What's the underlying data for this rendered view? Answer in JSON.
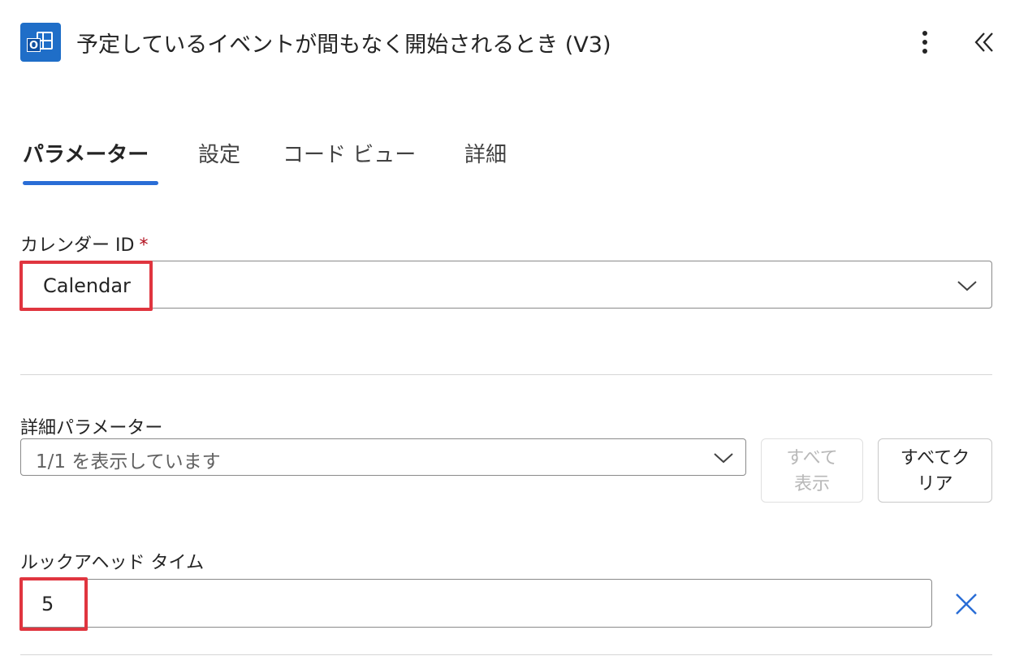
{
  "header": {
    "app_icon": "outlook-calendar-icon",
    "title": "予定しているイベントが間もなく開始されるとき (V3)",
    "more_icon": "more-vertical-icon",
    "collapse_icon": "double-chevron-left-icon"
  },
  "tabs": [
    {
      "label": "パラメーター",
      "active": true
    },
    {
      "label": "設定",
      "active": false
    },
    {
      "label": "コード ビュー",
      "active": false
    },
    {
      "label": "詳細",
      "active": false
    }
  ],
  "calendar_id": {
    "label": "カレンダー ID",
    "required_mark": "*",
    "value": "Calendar",
    "chevron_icon": "chevron-down-icon"
  },
  "advanced_params": {
    "label": "詳細パラメーター",
    "dropdown_value": "1/1 を表示しています",
    "chevron_icon": "chevron-down-icon",
    "show_all_button": "すべて\n表示",
    "clear_all_button": "すべてク\nリア"
  },
  "lookahead": {
    "label": "ルックアヘッド タイム",
    "value": "5",
    "clear_icon": "close-icon"
  },
  "colors": {
    "accent": "#2a6dd6",
    "highlight": "#e0353f",
    "required": "#b10e1c",
    "app_icon": "#1f6ec8"
  }
}
